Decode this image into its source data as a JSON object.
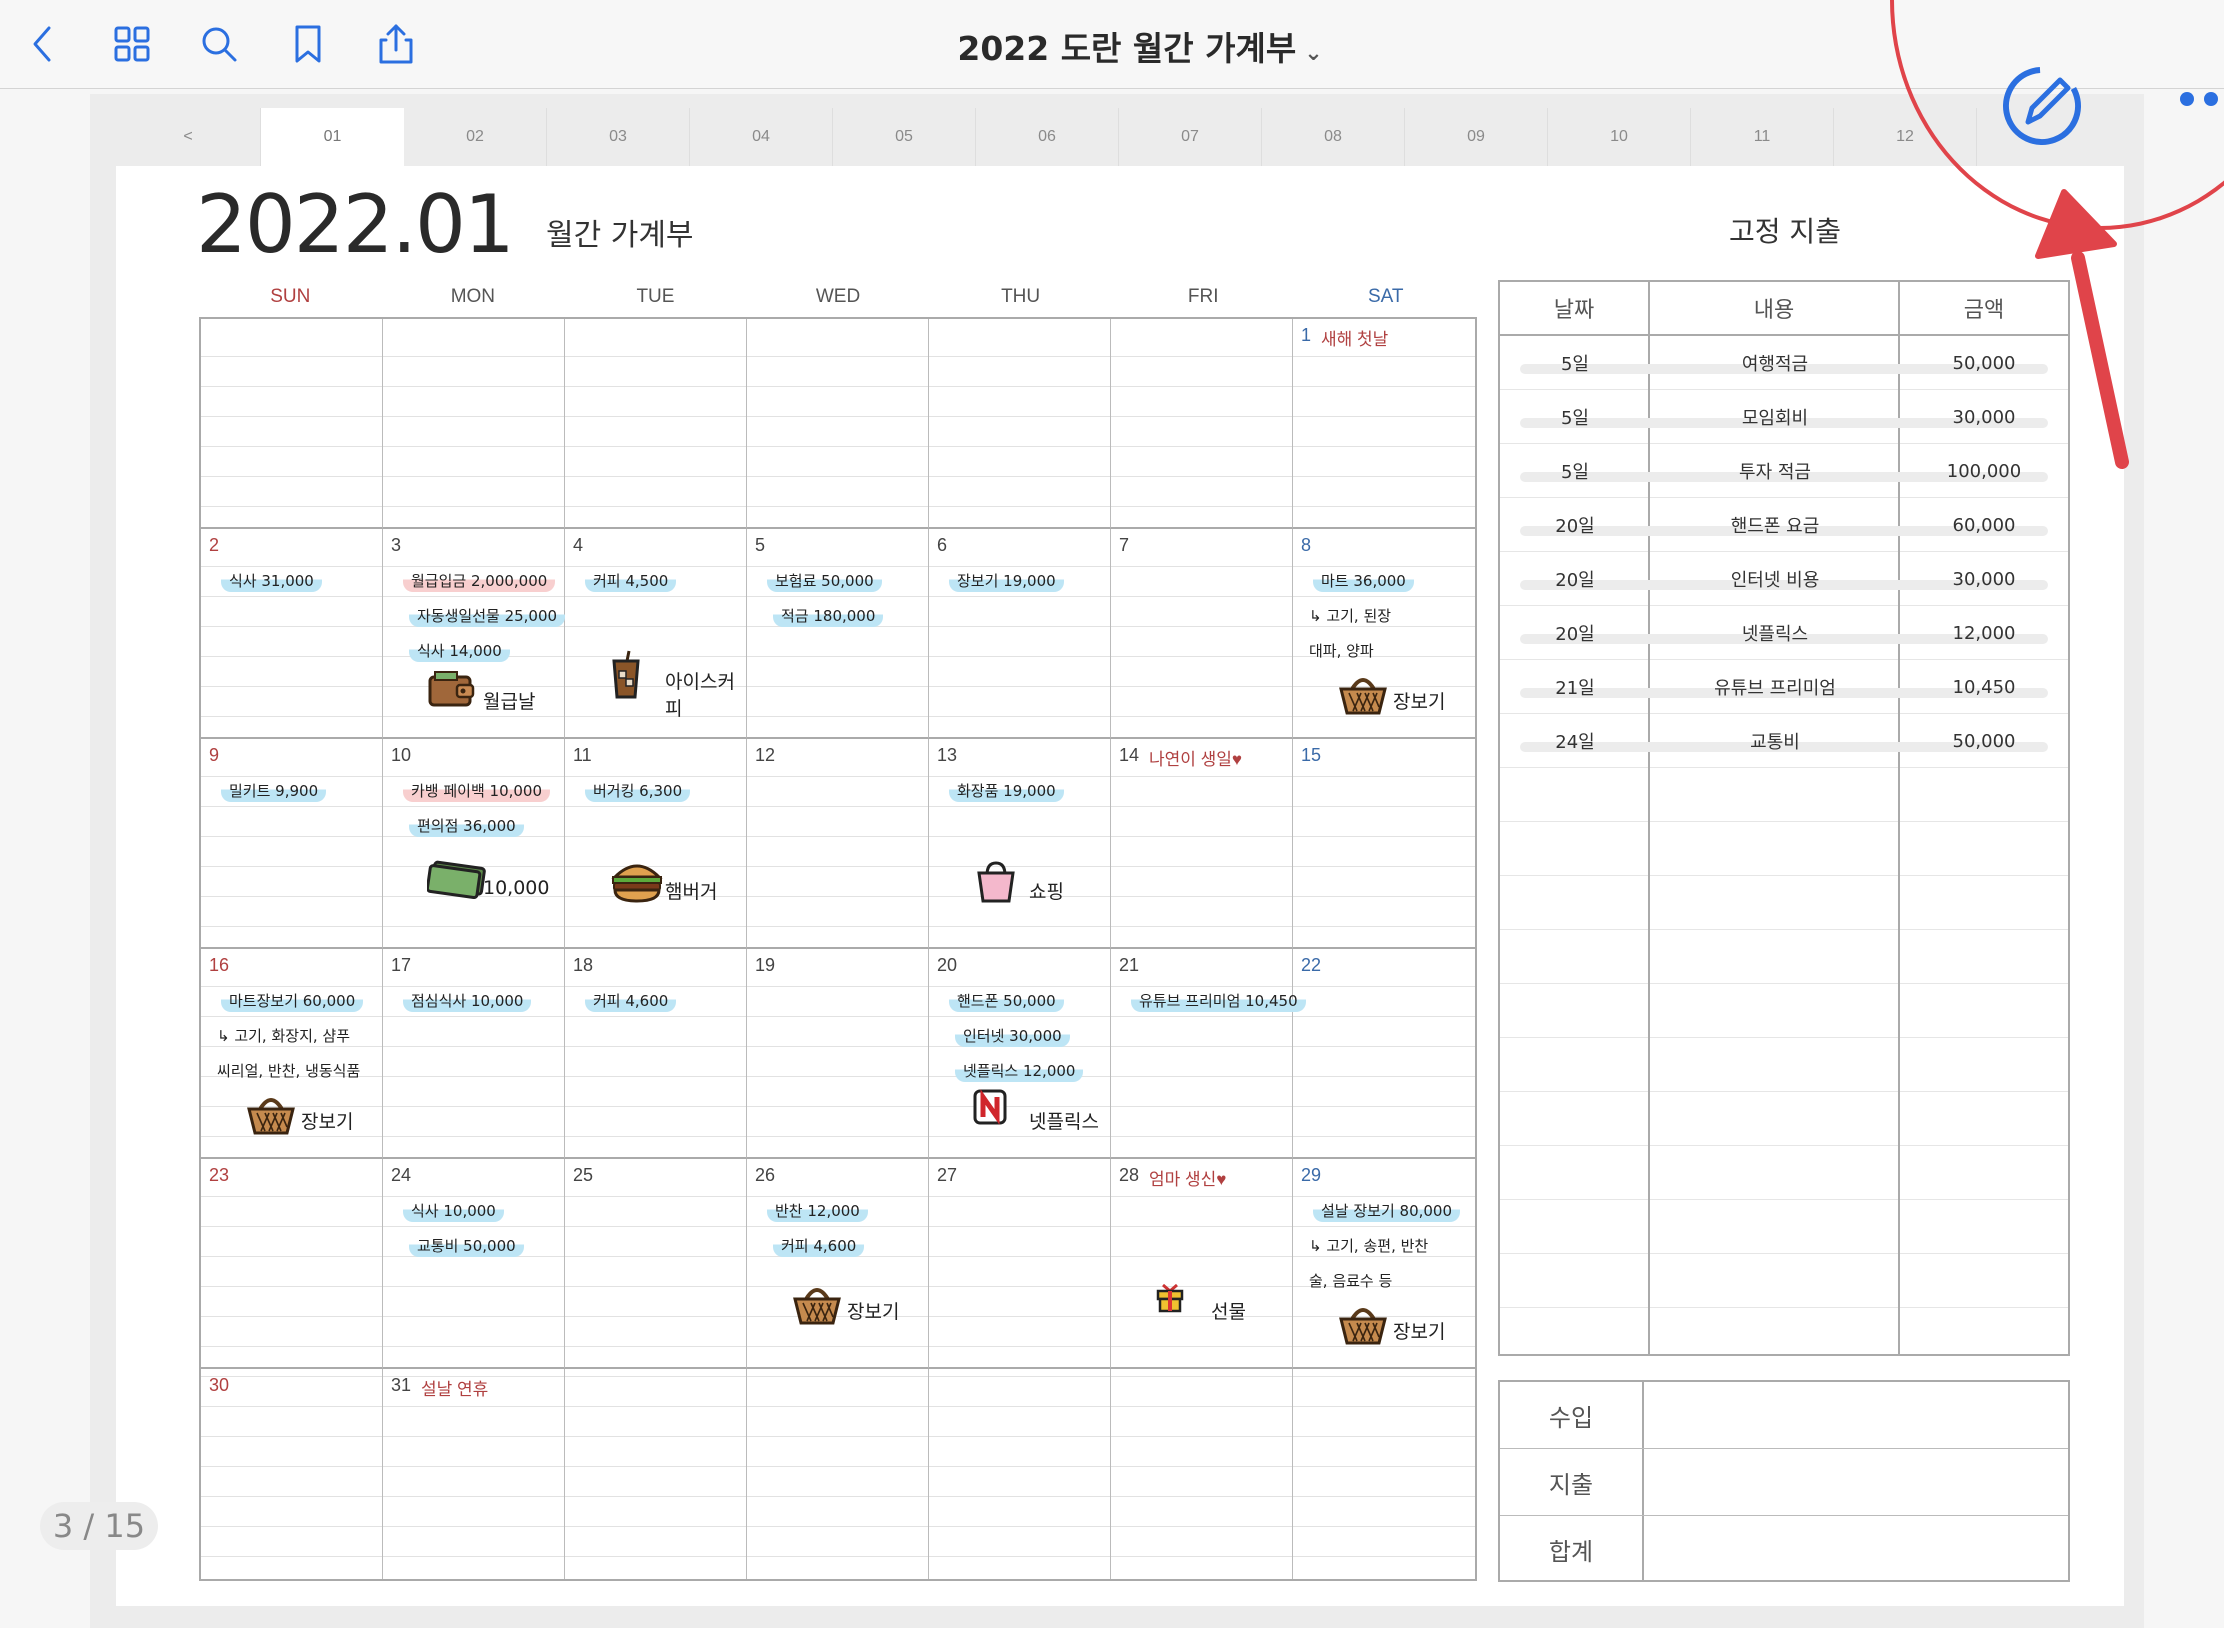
{
  "toolbar": {
    "title": "2022 도란 월간 가계부",
    "title_chevron": "⌄",
    "buttons": [
      "back",
      "grid",
      "search",
      "bookmark",
      "share",
      "edit",
      "more"
    ]
  },
  "tabs": [
    "<",
    "01",
    "02",
    "03",
    "04",
    "05",
    "06",
    "07",
    "08",
    "09",
    "10",
    "11",
    "12"
  ],
  "active_tab": "01",
  "page": {
    "year_month": "2022.01",
    "subtitle": "월간 가계부",
    "fixed_title": "고정 지출",
    "page_indicator": "3 / 15"
  },
  "weekdays": [
    "SUN",
    "MON",
    "TUE",
    "WED",
    "THU",
    "FRI",
    "SAT"
  ],
  "calendar": {
    "cells": [
      {
        "date": "",
        "entries": []
      },
      {
        "date": "",
        "entries": []
      },
      {
        "date": "",
        "entries": []
      },
      {
        "date": "",
        "entries": []
      },
      {
        "date": "",
        "entries": []
      },
      {
        "date": "",
        "entries": []
      },
      {
        "date": "1",
        "holiday": "새해 첫날",
        "entries": []
      },
      {
        "date": "2",
        "entries": [
          {
            "text": "식사 31,000",
            "style": "blue"
          }
        ]
      },
      {
        "date": "3",
        "entries": [
          {
            "text": "월급입금 2,000,000",
            "style": "pink"
          },
          {
            "text": "자동생일선물 25,000",
            "style": "blue"
          },
          {
            "text": "식사 14,000",
            "style": "blue"
          }
        ],
        "sticker": "wallet",
        "sticker_label": "월급날"
      },
      {
        "date": "4",
        "entries": [
          {
            "text": "커피 4,500",
            "style": "blue"
          }
        ],
        "sticker": "iced-coffee",
        "sticker_label": "아이스커피"
      },
      {
        "date": "5",
        "entries": [
          {
            "text": "보험료 50,000",
            "style": "blue"
          },
          {
            "text": "적금 180,000",
            "style": "blue"
          }
        ]
      },
      {
        "date": "6",
        "entries": [
          {
            "text": "장보기 19,000",
            "style": "blue"
          }
        ]
      },
      {
        "date": "7",
        "entries": []
      },
      {
        "date": "8",
        "entries": [
          {
            "text": "마트 36,000",
            "style": "blue"
          },
          {
            "text": "↳ 고기, 된장",
            "style": "plain"
          },
          {
            "text": "대파, 양파",
            "style": "plain"
          }
        ],
        "sticker": "basket",
        "sticker_label": "장보기"
      },
      {
        "date": "9",
        "entries": [
          {
            "text": "밀키트 9,900",
            "style": "blue"
          }
        ]
      },
      {
        "date": "10",
        "entries": [
          {
            "text": "카뱅 페이백 10,000",
            "style": "pink"
          },
          {
            "text": "편의점 36,000",
            "style": "blue"
          }
        ],
        "sticker": "cash",
        "sticker_label": "10,000"
      },
      {
        "date": "11",
        "entries": [
          {
            "text": "버거킹 6,300",
            "style": "blue"
          }
        ],
        "sticker": "burger",
        "sticker_label": "햄버거"
      },
      {
        "date": "12",
        "entries": []
      },
      {
        "date": "13",
        "entries": [
          {
            "text": "화장품 19,000",
            "style": "blue"
          }
        ],
        "sticker": "shopping-bag",
        "sticker_label": "쇼핑"
      },
      {
        "date": "14",
        "holiday": "나연이 생일♥",
        "entries": []
      },
      {
        "date": "15",
        "entries": []
      },
      {
        "date": "16",
        "entries": [
          {
            "text": "마트장보기 60,000",
            "style": "blue"
          },
          {
            "text": "↳ 고기, 화장지, 샴푸",
            "style": "plain"
          },
          {
            "text": "씨리얼, 반찬, 냉동식품",
            "style": "plain"
          }
        ],
        "sticker": "basket",
        "sticker_label": "장보기"
      },
      {
        "date": "17",
        "entries": [
          {
            "text": "점심식사 10,000",
            "style": "blue"
          }
        ]
      },
      {
        "date": "18",
        "entries": [
          {
            "text": "커피 4,600",
            "style": "blue"
          }
        ]
      },
      {
        "date": "19",
        "entries": []
      },
      {
        "date": "20",
        "entries": [
          {
            "text": "핸드폰 50,000",
            "style": "blue"
          },
          {
            "text": "인터넷 30,000",
            "style": "blue"
          },
          {
            "text": "넷플릭스 12,000",
            "style": "blue"
          }
        ],
        "sticker": "netflix",
        "sticker_label": "넷플릭스"
      },
      {
        "date": "21",
        "entries": [
          {
            "text": "유튜브 프리미엄 10,450",
            "style": "blue"
          }
        ]
      },
      {
        "date": "22",
        "entries": []
      },
      {
        "date": "23",
        "entries": []
      },
      {
        "date": "24",
        "entries": [
          {
            "text": "식사 10,000",
            "style": "blue"
          },
          {
            "text": "교통비 50,000",
            "style": "blue"
          }
        ]
      },
      {
        "date": "25",
        "entries": []
      },
      {
        "date": "26",
        "entries": [
          {
            "text": "반찬 12,000",
            "style": "blue"
          },
          {
            "text": "커피 4,600",
            "style": "blue"
          }
        ],
        "sticker": "basket",
        "sticker_label": "장보기"
      },
      {
        "date": "27",
        "entries": []
      },
      {
        "date": "28",
        "holiday": "엄마 생신♥",
        "entries": [],
        "sticker": "gift",
        "sticker_label": "선물"
      },
      {
        "date": "29",
        "entries": [
          {
            "text": "설날 장보기 80,000",
            "style": "blue"
          },
          {
            "text": "↳ 고기, 송편, 반찬",
            "style": "plain"
          },
          {
            "text": "술, 음료수 등",
            "style": "plain"
          }
        ],
        "sticker": "basket",
        "sticker_label": "장보기"
      },
      {
        "date": "30",
        "entries": []
      },
      {
        "date": "31",
        "holiday": "설날 연휴",
        "entries": []
      },
      {
        "date": "",
        "entries": []
      },
      {
        "date": "",
        "entries": []
      },
      {
        "date": "",
        "entries": []
      },
      {
        "date": "",
        "entries": []
      },
      {
        "date": "",
        "entries": []
      }
    ]
  },
  "fixed_expenses": {
    "headers": [
      "날짜",
      "내용",
      "금액"
    ],
    "rows": [
      {
        "day": "5일",
        "item": "여행적금",
        "amount": "50,000"
      },
      {
        "day": "5일",
        "item": "모임회비",
        "amount": "30,000"
      },
      {
        "day": "5일",
        "item": "투자 적금",
        "amount": "100,000"
      },
      {
        "day": "20일",
        "item": "핸드폰 요금",
        "amount": "60,000"
      },
      {
        "day": "20일",
        "item": "인터넷 비용",
        "amount": "30,000"
      },
      {
        "day": "20일",
        "item": "넷플릭스",
        "amount": "12,000"
      },
      {
        "day": "21일",
        "item": "유튜브 프리미엄",
        "amount": "10,450"
      },
      {
        "day": "24일",
        "item": "교통비",
        "amount": "50,000"
      }
    ]
  },
  "summary": {
    "income": "수입",
    "expense": "지출",
    "total": "합계"
  },
  "colors": {
    "accent": "#2b6fe0",
    "sunday": "#b04040",
    "saturday": "#3a6aa8",
    "highlight_blue": "#bde5f5",
    "highlight_pink": "#f8cfcf",
    "annotation": "#e0444a"
  }
}
